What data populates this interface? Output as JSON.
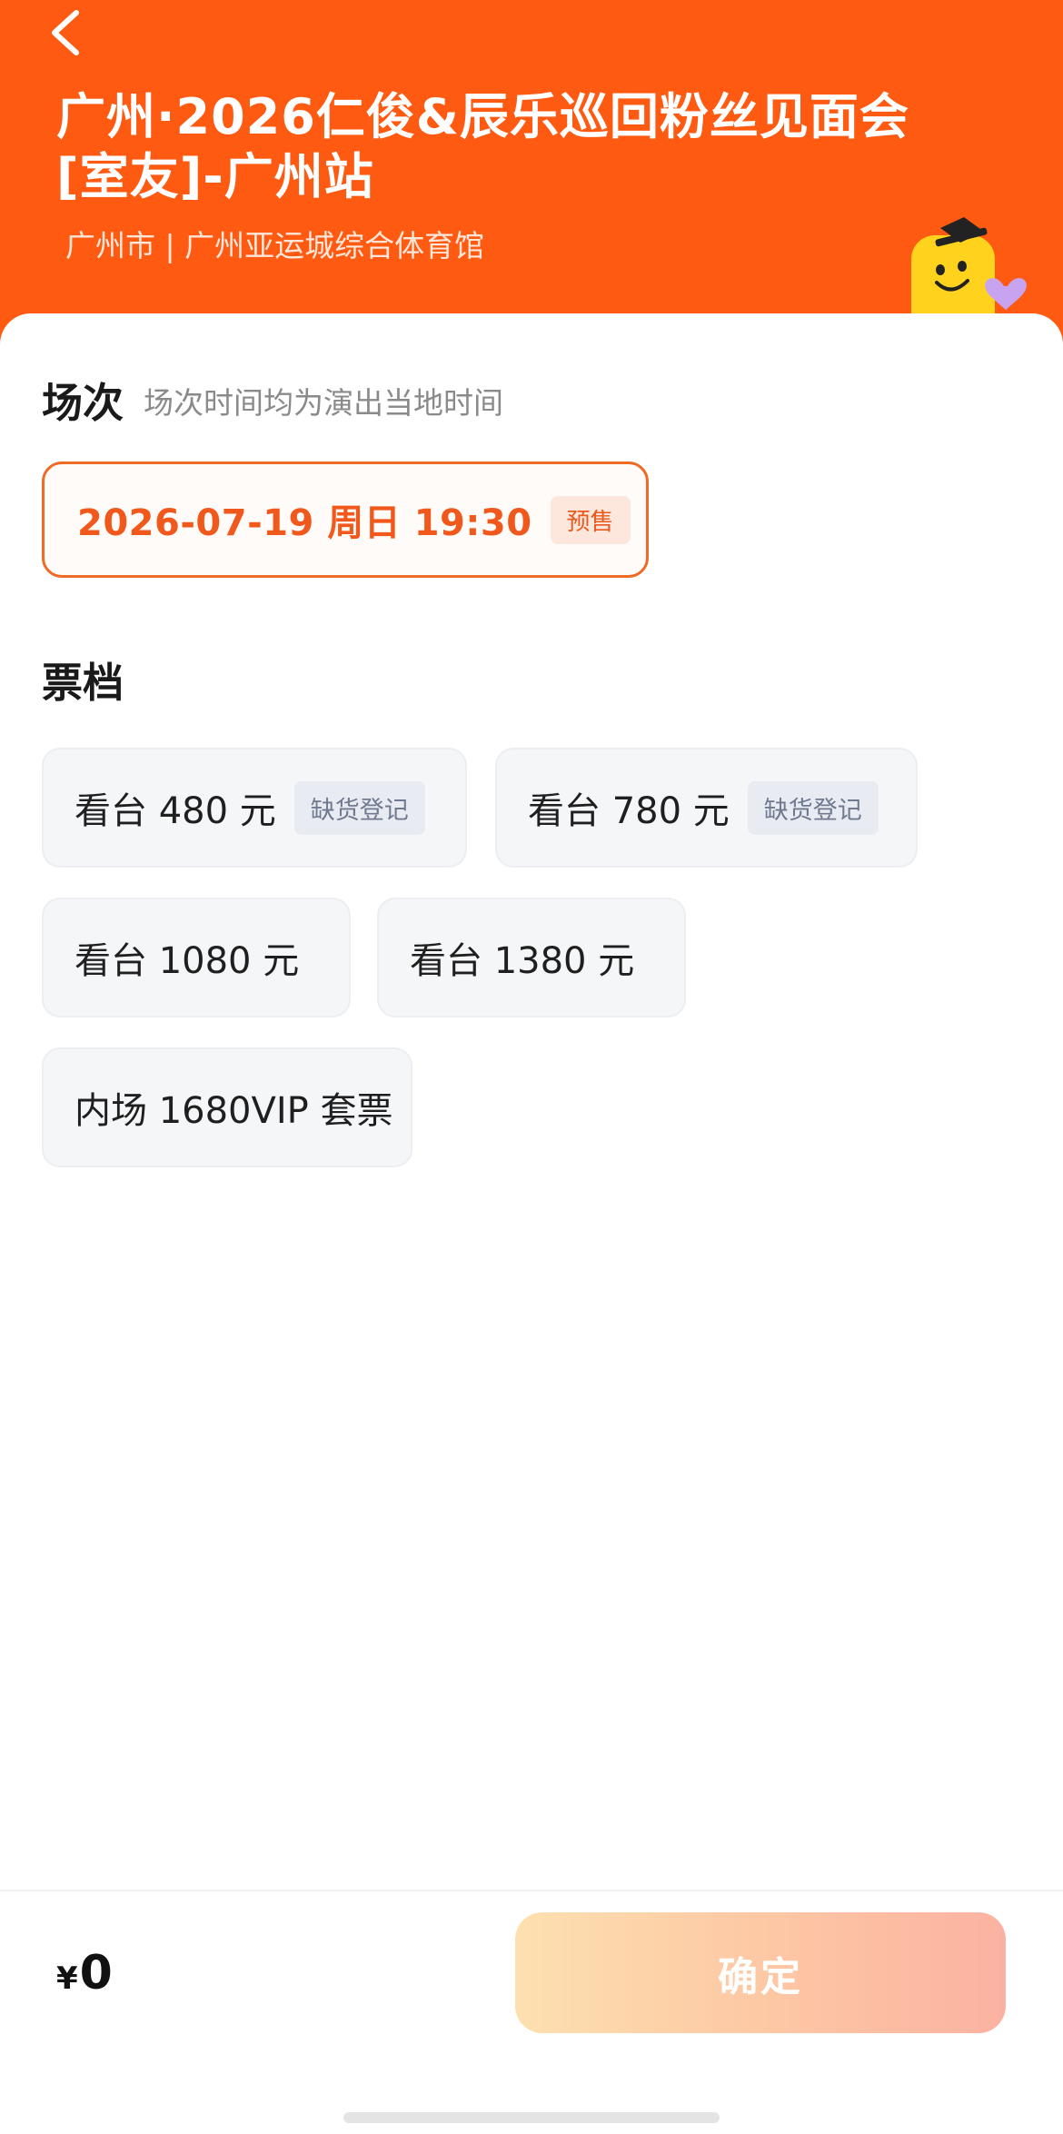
{
  "header": {
    "title": "广州·2026仁俊&辰乐巡回粉丝见面会[室友]-广州站",
    "location": "广州市 | 广州亚运城综合体育馆",
    "back_icon": "chevron-left-icon",
    "mascot_icon": "smiley-mascot-icon"
  },
  "session": {
    "heading": "场次",
    "hint": "场次时间均为演出当地时间",
    "options": [
      {
        "date": "2026-07-19  周日 19:30",
        "badge": "预售"
      }
    ]
  },
  "tiers": {
    "heading": "票档",
    "items": [
      {
        "label": "看台 480 元",
        "badge": "缺货登记"
      },
      {
        "label": "看台 780 元",
        "badge": "缺货登记"
      },
      {
        "label": "看台 1080 元"
      },
      {
        "label": "看台 1380 元"
      },
      {
        "label": "内场 1680VIP 套票"
      }
    ]
  },
  "footer": {
    "currency": "¥",
    "amount": "0",
    "confirm_label": "确定"
  },
  "colors": {
    "brand": "#fe5a12",
    "accent_border": "#ef6a24",
    "badge_text": "#6f7a90"
  }
}
